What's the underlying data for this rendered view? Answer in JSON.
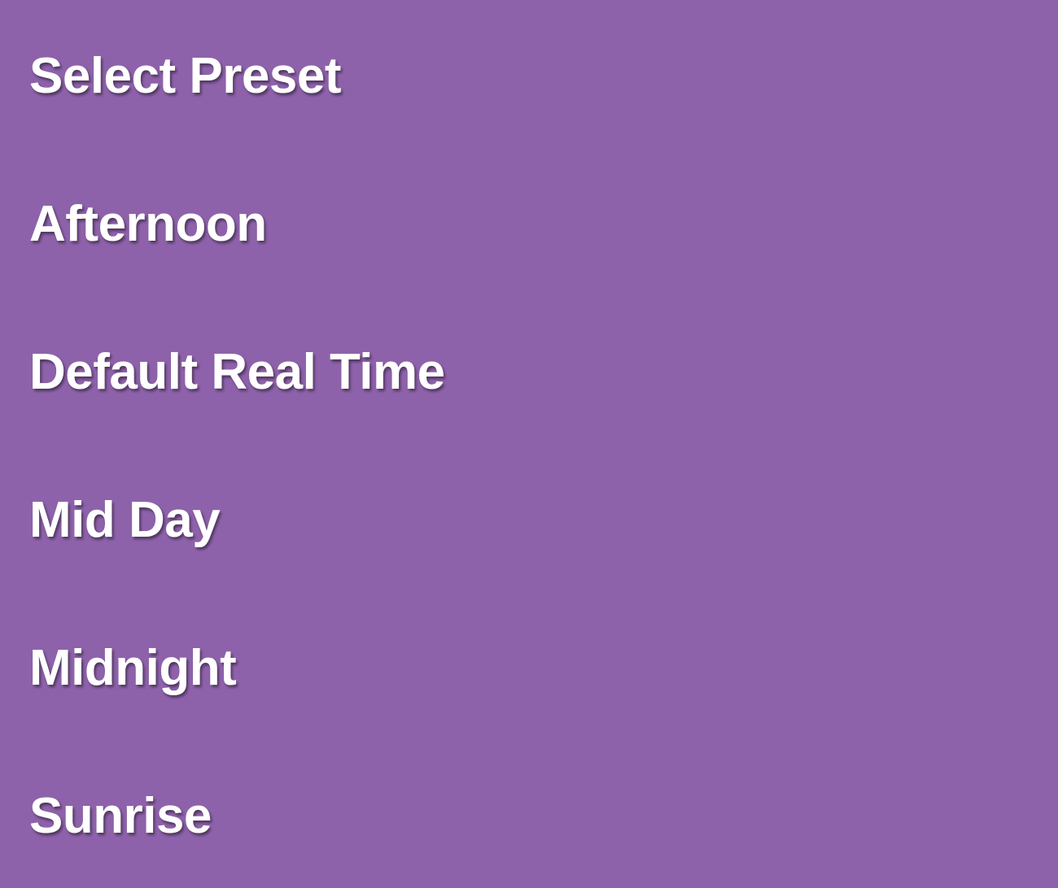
{
  "colors": {
    "background": "#8e62ab",
    "text": "#ffffff"
  },
  "menu": {
    "title": "Select Preset",
    "items": [
      {
        "label": "Afternoon"
      },
      {
        "label": "Default Real Time"
      },
      {
        "label": "Mid Day"
      },
      {
        "label": "Midnight"
      },
      {
        "label": "Sunrise"
      }
    ]
  }
}
